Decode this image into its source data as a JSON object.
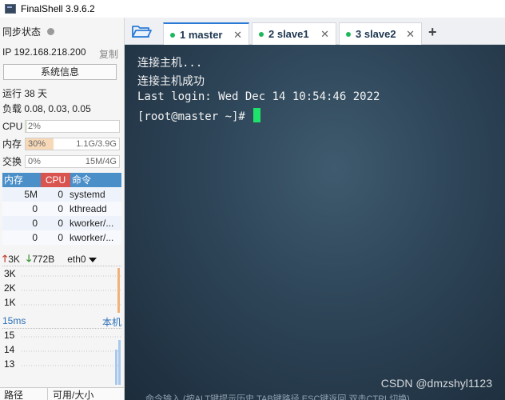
{
  "app": {
    "title": "FinalShell 3.9.6.2"
  },
  "sidebar": {
    "sync_label": "同步状态",
    "ip_label": "IP 192.168.218.200",
    "copy_label": "复制",
    "sysinfo_button": "系统信息",
    "uptime": "运行 38 天",
    "load": "负载 0.08, 0.03, 0.05",
    "meters": [
      {
        "label": "CPU",
        "percent": "2%",
        "fraction": 0.02,
        "value": "",
        "color": "#d9e8d0"
      },
      {
        "label": "内存",
        "percent": "30%",
        "fraction": 0.3,
        "value": "1.1G/3.9G",
        "color": "#f7d9b8"
      },
      {
        "label": "交换",
        "percent": "0%",
        "fraction": 0.0,
        "value": "15M/4G",
        "color": "#d9e8d0"
      }
    ],
    "process_table": {
      "headers": [
        "内存",
        "CPU",
        "命令"
      ],
      "rows": [
        [
          "5M",
          "0",
          "systemd"
        ],
        [
          "0",
          "0",
          "kthreadd"
        ],
        [
          "0",
          "0",
          "kworker/..."
        ],
        [
          "0",
          "0",
          "kworker/..."
        ]
      ]
    },
    "network": {
      "upload": "3K",
      "download": "772B",
      "interface": "eth0",
      "axis": [
        "3K",
        "2K",
        "1K"
      ]
    },
    "ping": {
      "label": "15ms",
      "target": "本机",
      "axis": [
        "15",
        "14",
        "13"
      ]
    },
    "file_columns": [
      "路径",
      "可用/大小"
    ]
  },
  "tabs": [
    {
      "label": "1 master",
      "active": true
    },
    {
      "label": "2 slave1",
      "active": false
    },
    {
      "label": "3 slave2",
      "active": false
    }
  ],
  "add_tab_label": "+",
  "terminal": {
    "lines": [
      "连接主机...",
      "连接主机成功",
      "Last login: Wed Dec 14 10:54:46 2022",
      "[root@master ~]# "
    ],
    "watermark": "CSDN @dmzshyl1123",
    "input_hint": "命令输入 (按ALT键提示历史,TAB键路径,ESC键返回,双击CTRL切换)"
  },
  "colors": {
    "accent": "#2b7bd6",
    "connected": "#1fb75d",
    "cursor": "#1ee36a"
  }
}
